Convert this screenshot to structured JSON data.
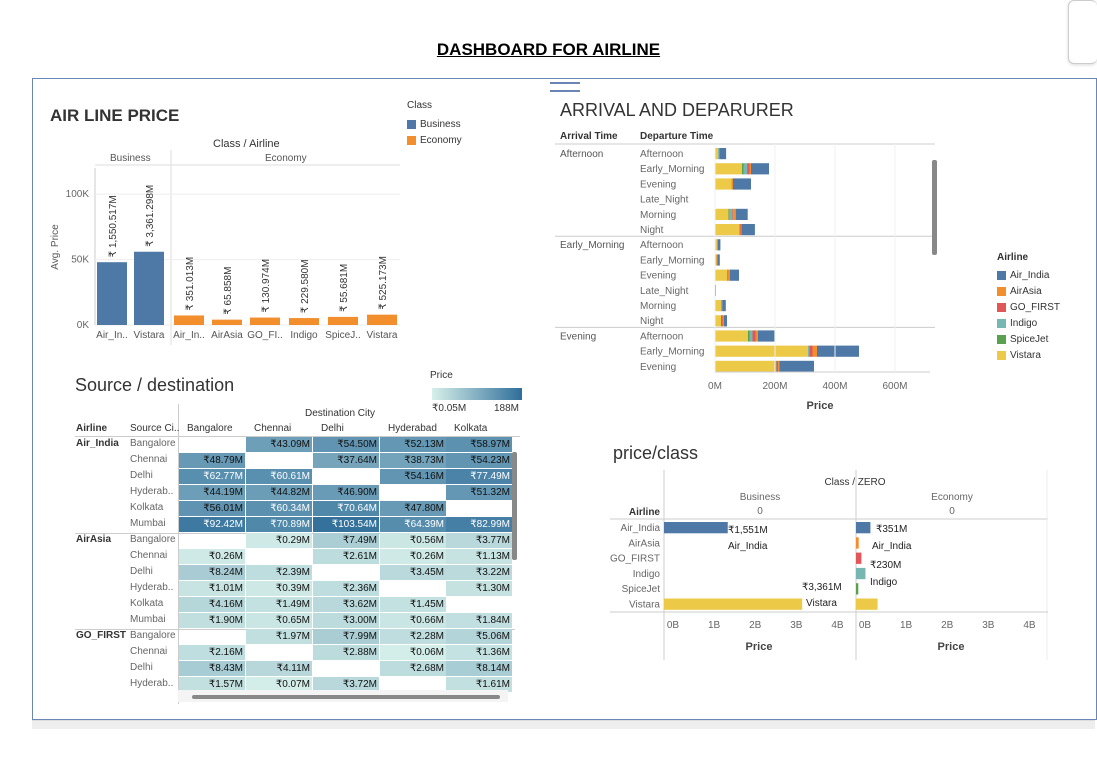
{
  "page_title": "DASHBOARD FOR AIRLINE",
  "airline_price": {
    "title": "AIR LINE PRICE",
    "header": "Class / Airline",
    "class_business": "Business",
    "class_economy": "Economy",
    "ylabel": "Avg. Price",
    "yticks": [
      "100K",
      "50K",
      "0K"
    ],
    "legend_title": "Class",
    "legend": [
      {
        "label": "Business",
        "color": "#4e79a7"
      },
      {
        "label": "Economy",
        "color": "#f28e2b"
      }
    ]
  },
  "arrival": {
    "title": "ARRIVAL AND DEPARURER",
    "col1": "Arrival Time",
    "col2": "Departure Time",
    "xlabel": "Price",
    "xticks": [
      "0M",
      "200M",
      "400M",
      "600M"
    ],
    "legend_title": "Airline",
    "legend": [
      {
        "label": "Air_India",
        "color": "#4e79a7"
      },
      {
        "label": "AirAsia",
        "color": "#f28e2b"
      },
      {
        "label": "GO_FIRST",
        "color": "#e15759"
      },
      {
        "label": "Indigo",
        "color": "#76b7b2"
      },
      {
        "label": "SpiceJet",
        "color": "#59a14f"
      },
      {
        "label": "Vistara",
        "color": "#edc948"
      }
    ],
    "groups": [
      {
        "name": "Afternoon",
        "rows": [
          "Afternoon",
          "Early_Morning",
          "Evening",
          "Late_Night",
          "Morning",
          "Night"
        ]
      },
      {
        "name": "Early_Morning",
        "rows": [
          "Afternoon",
          "Early_Morning",
          "Evening",
          "Late_Night",
          "Morning",
          "Night"
        ]
      },
      {
        "name": "Evening",
        "rows": [
          "Afternoon",
          "Early_Morning",
          "Evening"
        ]
      }
    ]
  },
  "source_dest": {
    "title": "Source / destination",
    "legend_title": "Price",
    "legend_min": "₹0.05M",
    "legend_max": "188M",
    "col_airline": "Airline",
    "col_source": "Source Ci..",
    "dest_header": "Destination City",
    "dest_cols": [
      "Bangalore",
      "Chennai",
      "Delhi",
      "Hyderabad",
      "Kolkata"
    ],
    "groups": [
      {
        "airline": "Air_India",
        "rows": [
          {
            "src": "Bangalore",
            "vals": [
              "",
              "₹43.09M",
              "₹54.50M",
              "₹52.13M",
              "₹58.97M"
            ]
          },
          {
            "src": "Chennai",
            "vals": [
              "₹48.79M",
              "",
              "₹37.64M",
              "₹38.73M",
              "₹54.23M"
            ]
          },
          {
            "src": "Delhi",
            "vals": [
              "₹62.77M",
              "₹60.61M",
              "",
              "₹54.16M",
              "₹77.49M"
            ]
          },
          {
            "src": "Hyderab..",
            "vals": [
              "₹44.19M",
              "₹44.82M",
              "₹46.90M",
              "",
              "₹51.32M"
            ]
          },
          {
            "src": "Kolkata",
            "vals": [
              "₹56.01M",
              "₹60.34M",
              "₹70.64M",
              "₹47.80M",
              ""
            ]
          },
          {
            "src": "Mumbai",
            "vals": [
              "₹92.42M",
              "₹70.89M",
              "₹103.54M",
              "₹64.39M",
              "₹82.99M"
            ]
          }
        ]
      },
      {
        "airline": "AirAsia",
        "rows": [
          {
            "src": "Bangalore",
            "vals": [
              "",
              "₹0.29M",
              "₹7.49M",
              "₹0.56M",
              "₹3.77M"
            ]
          },
          {
            "src": "Chennai",
            "vals": [
              "₹0.26M",
              "",
              "₹2.61M",
              "₹0.26M",
              "₹1.13M"
            ]
          },
          {
            "src": "Delhi",
            "vals": [
              "₹8.24M",
              "₹2.39M",
              "",
              "₹3.45M",
              "₹3.22M"
            ]
          },
          {
            "src": "Hyderab..",
            "vals": [
              "₹1.01M",
              "₹0.39M",
              "₹2.36M",
              "",
              "₹1.30M"
            ]
          },
          {
            "src": "Kolkata",
            "vals": [
              "₹4.16M",
              "₹1.49M",
              "₹3.62M",
              "₹1.45M",
              ""
            ]
          },
          {
            "src": "Mumbai",
            "vals": [
              "₹1.90M",
              "₹0.65M",
              "₹3.00M",
              "₹0.66M",
              "₹1.84M"
            ]
          }
        ]
      },
      {
        "airline": "GO_FIRST",
        "rows": [
          {
            "src": "Bangalore",
            "vals": [
              "",
              "₹1.97M",
              "₹7.99M",
              "₹2.28M",
              "₹5.06M"
            ]
          },
          {
            "src": "Chennai",
            "vals": [
              "₹2.16M",
              "",
              "₹2.88M",
              "₹0.06M",
              "₹1.36M"
            ]
          },
          {
            "src": "Delhi",
            "vals": [
              "₹8.43M",
              "₹4.11M",
              "",
              "₹2.68M",
              "₹8.14M"
            ]
          },
          {
            "src": "Hyderab..",
            "vals": [
              "₹1.57M",
              "₹0.07M",
              "₹3.72M",
              "",
              "₹1.61M"
            ]
          }
        ]
      }
    ]
  },
  "price_class": {
    "title": "price/class",
    "header": "Class / ZERO",
    "col_airline": "Airline",
    "panel_business": "Business",
    "panel_economy": "Economy",
    "panel_sub": "0",
    "airlines": [
      "Air_India",
      "AirAsia",
      "GO_FIRST",
      "Indigo",
      "SpiceJet",
      "Vistara"
    ],
    "xticks": [
      "0B",
      "1B",
      "2B",
      "3B",
      "4B"
    ],
    "xlabel": "Price"
  },
  "chart_data": [
    {
      "type": "bar",
      "title": "AIR LINE PRICE",
      "ylabel": "Avg. Price",
      "ylim": [
        0,
        120000
      ],
      "categories": [
        "Air_In..",
        "Vistara",
        "Air_In..",
        "AirAsia",
        "GO_FI..",
        "Indigo",
        "SpiceJ..",
        "Vistara"
      ],
      "classes": [
        "Business",
        "Business",
        "Economy",
        "Economy",
        "Economy",
        "Economy",
        "Economy",
        "Economy"
      ],
      "values": [
        48000,
        56000,
        7300,
        4100,
        5700,
        5300,
        6200,
        7900
      ],
      "labels": [
        "₹ 1,550.517M",
        "₹ 3,361.298M",
        "₹ 351.013M",
        "₹ 65.858M",
        "₹ 130.974M",
        "₹ 229.580M",
        "₹ 55.681M",
        "₹ 525.173M"
      ]
    },
    {
      "type": "bar",
      "title": "ARRIVAL AND DEPARURER",
      "orientation": "horizontal",
      "stacked": true,
      "xlabel": "Price",
      "xlim": [
        0,
        700
      ],
      "unit": "M",
      "series_order": [
        "Vistara",
        "SpiceJet",
        "Indigo",
        "GO_FIRST",
        "AirAsia",
        "Air_India"
      ],
      "rows": [
        {
          "arr": "Afternoon",
          "dep": "Afternoon",
          "vals": [
            10,
            0,
            3,
            0,
            2,
            22
          ]
        },
        {
          "arr": "Afternoon",
          "dep": "Early_Morning",
          "vals": [
            90,
            5,
            12,
            8,
            5,
            60
          ]
        },
        {
          "arr": "Afternoon",
          "dep": "Evening",
          "vals": [
            55,
            0,
            0,
            0,
            5,
            60
          ]
        },
        {
          "arr": "Afternoon",
          "dep": "Late_Night",
          "vals": [
            0,
            0,
            0,
            0,
            0,
            0
          ]
        },
        {
          "arr": "Afternoon",
          "dep": "Morning",
          "vals": [
            45,
            3,
            10,
            3,
            8,
            40
          ]
        },
        {
          "arr": "Afternoon",
          "dep": "Night",
          "vals": [
            80,
            0,
            3,
            2,
            3,
            45
          ]
        },
        {
          "arr": "Early_Morning",
          "dep": "Afternoon",
          "vals": [
            6,
            0,
            0,
            0,
            4,
            8
          ]
        },
        {
          "arr": "Early_Morning",
          "dep": "Early_Morning",
          "vals": [
            5,
            0,
            0,
            0,
            3,
            8
          ]
        },
        {
          "arr": "Early_Morning",
          "dep": "Evening",
          "vals": [
            40,
            0,
            0,
            2,
            8,
            30
          ]
        },
        {
          "arr": "Early_Morning",
          "dep": "Late_Night",
          "vals": [
            0,
            0,
            0,
            0,
            0,
            3
          ]
        },
        {
          "arr": "Early_Morning",
          "dep": "Morning",
          "vals": [
            20,
            0,
            0,
            0,
            4,
            12
          ]
        },
        {
          "arr": "Early_Morning",
          "dep": "Night",
          "vals": [
            20,
            0,
            0,
            5,
            5,
            10
          ]
        },
        {
          "arr": "Evening",
          "dep": "Afternoon",
          "vals": [
            110,
            5,
            10,
            10,
            8,
            55
          ]
        },
        {
          "arr": "Evening",
          "dep": "Early_Morning",
          "vals": [
            310,
            0,
            5,
            10,
            15,
            140
          ]
        },
        {
          "arr": "Evening",
          "dep": "Evening",
          "vals": [
            200,
            0,
            5,
            5,
            5,
            115
          ]
        }
      ]
    },
    {
      "type": "heatmap",
      "title": "Source / destination",
      "range": [
        0.05,
        188
      ],
      "unit": "M"
    },
    {
      "type": "bar",
      "title": "price/class",
      "orientation": "horizontal",
      "xlabel": "Price",
      "xlim": [
        0,
        4.5
      ],
      "unit": "B",
      "categories": [
        "Air_India",
        "AirAsia",
        "GO_FIRST",
        "Indigo",
        "SpiceJet",
        "Vistara"
      ],
      "series": [
        {
          "name": "Business",
          "values": [
            1.551,
            0,
            0,
            0,
            0,
            3.361
          ]
        },
        {
          "name": "Economy",
          "values": [
            0.351,
            0.066,
            0.131,
            0.23,
            0.056,
            0.525
          ]
        }
      ],
      "colors": [
        "#4e79a7",
        "#f28e2b",
        "#e15759",
        "#76b7b2",
        "#59a14f",
        "#edc948"
      ],
      "value_labels": {
        "Business": [
          {
            "label": "₹1,551M",
            "name": "Air_India"
          },
          {
            "label": "₹3,361M",
            "name": "Vistara"
          }
        ],
        "Economy": [
          {
            "label": "₹351M",
            "name": "Air_India"
          },
          {
            "label": "₹230M",
            "name": "Indigo"
          }
        ]
      }
    }
  ]
}
